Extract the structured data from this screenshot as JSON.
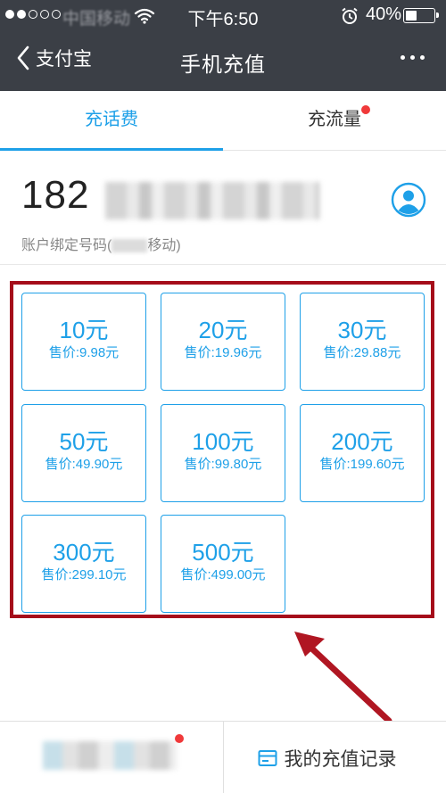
{
  "status_bar": {
    "carrier": "中国移动",
    "time": "下午6:50",
    "battery": "40%",
    "battery_level": 0.4
  },
  "nav": {
    "back_label": "支付宝",
    "title": "手机充值"
  },
  "tabs": [
    {
      "label": "充话费",
      "active": true
    },
    {
      "label": "充流量",
      "active": false
    }
  ],
  "phone": {
    "number_prefix": "182",
    "account_label": "账户绑定号码(",
    "account_suffix": "移动)"
  },
  "options": [
    {
      "amount": "10元",
      "price": "售价:9.98元"
    },
    {
      "amount": "20元",
      "price": "售价:19.96元"
    },
    {
      "amount": "30元",
      "price": "售价:29.88元"
    },
    {
      "amount": "50元",
      "price": "售价:49.90元"
    },
    {
      "amount": "100元",
      "price": "售价:99.80元"
    },
    {
      "amount": "200元",
      "price": "售价:199.60元"
    },
    {
      "amount": "300元",
      "price": "售价:299.10元"
    },
    {
      "amount": "500元",
      "price": "售价:499.00元"
    }
  ],
  "bottom": {
    "history_label": "我的充值记录"
  },
  "colors": {
    "accent": "#1ea0e8",
    "highlight_frame": "#a50d1a",
    "nav_bg": "#3b3f46",
    "badge": "#f0393a"
  },
  "icons": {
    "back": "chevron-left-icon",
    "more": "more-dots-icon",
    "avatar": "contact-avatar-icon",
    "history": "card-icon"
  }
}
